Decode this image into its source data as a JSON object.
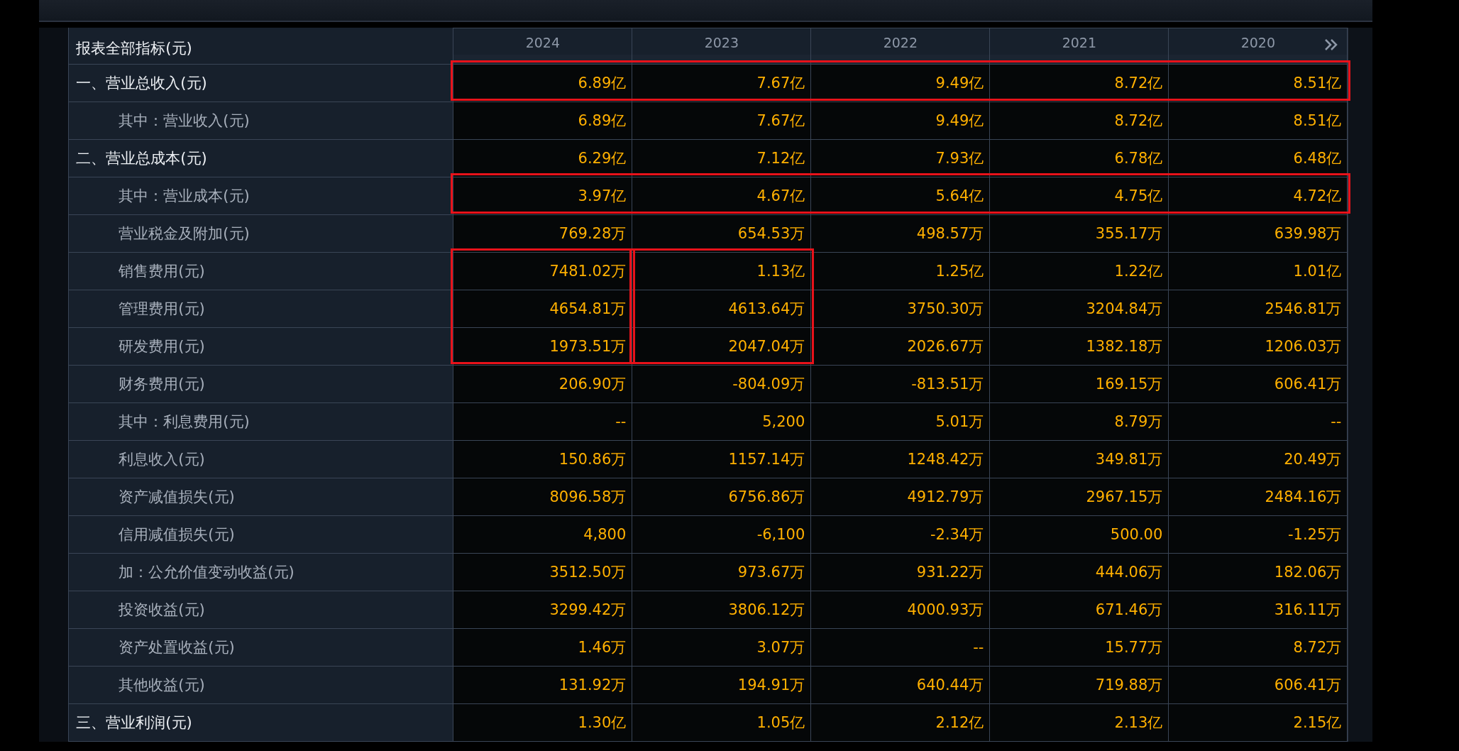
{
  "table": {
    "header_label": "报表全部指标(元)",
    "columns": [
      "2024",
      "2023",
      "2022",
      "2021",
      "2020"
    ],
    "rows": [
      {
        "kind": "main",
        "label": "一、营业总收入(元)",
        "values": [
          {
            "text": "6.89亿",
            "boxed": true
          },
          {
            "text": "7.67亿",
            "boxed": true
          },
          {
            "text": "9.49亿",
            "boxed": true
          },
          {
            "text": "8.72亿",
            "boxed": true
          },
          {
            "text": "8.51亿",
            "boxed": true
          }
        ]
      },
      {
        "kind": "sub",
        "label": "其中：营业收入(元)",
        "values": [
          {
            "text": "6.89亿",
            "boxed": false
          },
          {
            "text": "7.67亿",
            "boxed": false
          },
          {
            "text": "9.49亿",
            "boxed": false
          },
          {
            "text": "8.72亿",
            "boxed": false
          },
          {
            "text": "8.51亿",
            "boxed": false
          }
        ]
      },
      {
        "kind": "main",
        "label": "二、营业总成本(元)",
        "values": [
          {
            "text": "6.29亿",
            "boxed": false
          },
          {
            "text": "7.12亿",
            "boxed": false
          },
          {
            "text": "7.93亿",
            "boxed": false
          },
          {
            "text": "6.78亿",
            "boxed": false
          },
          {
            "text": "6.48亿",
            "boxed": false
          }
        ]
      },
      {
        "kind": "sub",
        "label": "其中：营业成本(元)",
        "values": [
          {
            "text": "3.97亿",
            "boxed": true
          },
          {
            "text": "4.67亿",
            "boxed": true
          },
          {
            "text": "5.64亿",
            "boxed": true
          },
          {
            "text": "4.75亿",
            "boxed": true
          },
          {
            "text": "4.72亿",
            "boxed": true
          }
        ]
      },
      {
        "kind": "sub",
        "label": "营业税金及附加(元)",
        "values": [
          {
            "text": "769.28万",
            "boxed": false
          },
          {
            "text": "654.53万",
            "boxed": false
          },
          {
            "text": "498.57万",
            "boxed": false
          },
          {
            "text": "355.17万",
            "boxed": false
          },
          {
            "text": "639.98万",
            "boxed": false
          }
        ]
      },
      {
        "kind": "sub",
        "label": "销售费用(元)",
        "values": [
          {
            "text": "7481.02万",
            "boxed": true
          },
          {
            "text": "1.13亿",
            "boxed": true
          },
          {
            "text": "1.25亿",
            "boxed": false
          },
          {
            "text": "1.22亿",
            "boxed": false
          },
          {
            "text": "1.01亿",
            "boxed": false
          }
        ]
      },
      {
        "kind": "sub",
        "label": "管理费用(元)",
        "values": [
          {
            "text": "4654.81万",
            "boxed": true
          },
          {
            "text": "4613.64万",
            "boxed": true
          },
          {
            "text": "3750.30万",
            "boxed": false
          },
          {
            "text": "3204.84万",
            "boxed": false
          },
          {
            "text": "2546.81万",
            "boxed": false
          }
        ]
      },
      {
        "kind": "sub",
        "label": "研发费用(元)",
        "values": [
          {
            "text": "1973.51万",
            "boxed": true
          },
          {
            "text": "2047.04万",
            "boxed": true
          },
          {
            "text": "2026.67万",
            "boxed": false
          },
          {
            "text": "1382.18万",
            "boxed": false
          },
          {
            "text": "1206.03万",
            "boxed": false
          }
        ]
      },
      {
        "kind": "sub",
        "label": "财务费用(元)",
        "values": [
          {
            "text": "206.90万",
            "boxed": false
          },
          {
            "text": "-804.09万",
            "boxed": false
          },
          {
            "text": "-813.51万",
            "boxed": false
          },
          {
            "text": "169.15万",
            "boxed": false
          },
          {
            "text": "606.41万",
            "boxed": false
          }
        ]
      },
      {
        "kind": "sub",
        "label": "其中：利息费用(元)",
        "values": [
          {
            "text": "--",
            "boxed": false
          },
          {
            "text": "5,200",
            "boxed": false
          },
          {
            "text": "5.01万",
            "boxed": false
          },
          {
            "text": "8.79万",
            "boxed": false
          },
          {
            "text": "--",
            "boxed": false
          }
        ]
      },
      {
        "kind": "sub",
        "label": "利息收入(元)",
        "values": [
          {
            "text": "150.86万",
            "boxed": false
          },
          {
            "text": "1157.14万",
            "boxed": false
          },
          {
            "text": "1248.42万",
            "boxed": false
          },
          {
            "text": "349.81万",
            "boxed": false
          },
          {
            "text": "20.49万",
            "boxed": false
          }
        ]
      },
      {
        "kind": "sub",
        "label": "资产减值损失(元)",
        "values": [
          {
            "text": "8096.58万",
            "boxed": false
          },
          {
            "text": "6756.86万",
            "boxed": false
          },
          {
            "text": "4912.79万",
            "boxed": false
          },
          {
            "text": "2967.15万",
            "boxed": false
          },
          {
            "text": "2484.16万",
            "boxed": false
          }
        ]
      },
      {
        "kind": "sub",
        "label": "信用减值损失(元)",
        "values": [
          {
            "text": "4,800",
            "boxed": false
          },
          {
            "text": "-6,100",
            "boxed": false
          },
          {
            "text": "-2.34万",
            "boxed": false
          },
          {
            "text": "500.00",
            "boxed": false
          },
          {
            "text": "-1.25万",
            "boxed": false
          }
        ]
      },
      {
        "kind": "sub",
        "label": "加：公允价值变动收益(元)",
        "values": [
          {
            "text": "3512.50万",
            "boxed": false
          },
          {
            "text": "973.67万",
            "boxed": false
          },
          {
            "text": "931.22万",
            "boxed": false
          },
          {
            "text": "444.06万",
            "boxed": false
          },
          {
            "text": "182.06万",
            "boxed": false
          }
        ]
      },
      {
        "kind": "sub",
        "label": "投资收益(元)",
        "values": [
          {
            "text": "3299.42万",
            "boxed": false
          },
          {
            "text": "3806.12万",
            "boxed": false
          },
          {
            "text": "4000.93万",
            "boxed": false
          },
          {
            "text": "671.46万",
            "boxed": false
          },
          {
            "text": "316.11万",
            "boxed": false
          }
        ]
      },
      {
        "kind": "sub",
        "label": "资产处置收益(元)",
        "values": [
          {
            "text": "1.46万",
            "boxed": false
          },
          {
            "text": "3.07万",
            "boxed": false
          },
          {
            "text": "--",
            "boxed": false
          },
          {
            "text": "15.77万",
            "boxed": false
          },
          {
            "text": "8.72万",
            "boxed": false
          }
        ]
      },
      {
        "kind": "sub",
        "label": "其他收益(元)",
        "values": [
          {
            "text": "131.92万",
            "boxed": false
          },
          {
            "text": "194.91万",
            "boxed": false
          },
          {
            "text": "640.44万",
            "boxed": false
          },
          {
            "text": "719.88万",
            "boxed": false
          },
          {
            "text": "606.41万",
            "boxed": false
          }
        ]
      },
      {
        "kind": "main",
        "label": "三、营业利润(元)",
        "values": [
          {
            "text": "1.30亿",
            "boxed": false
          },
          {
            "text": "1.05亿",
            "boxed": false
          },
          {
            "text": "2.12亿",
            "boxed": false
          },
          {
            "text": "2.13亿",
            "boxed": false
          },
          {
            "text": "2.15亿",
            "boxed": false
          }
        ]
      }
    ]
  }
}
